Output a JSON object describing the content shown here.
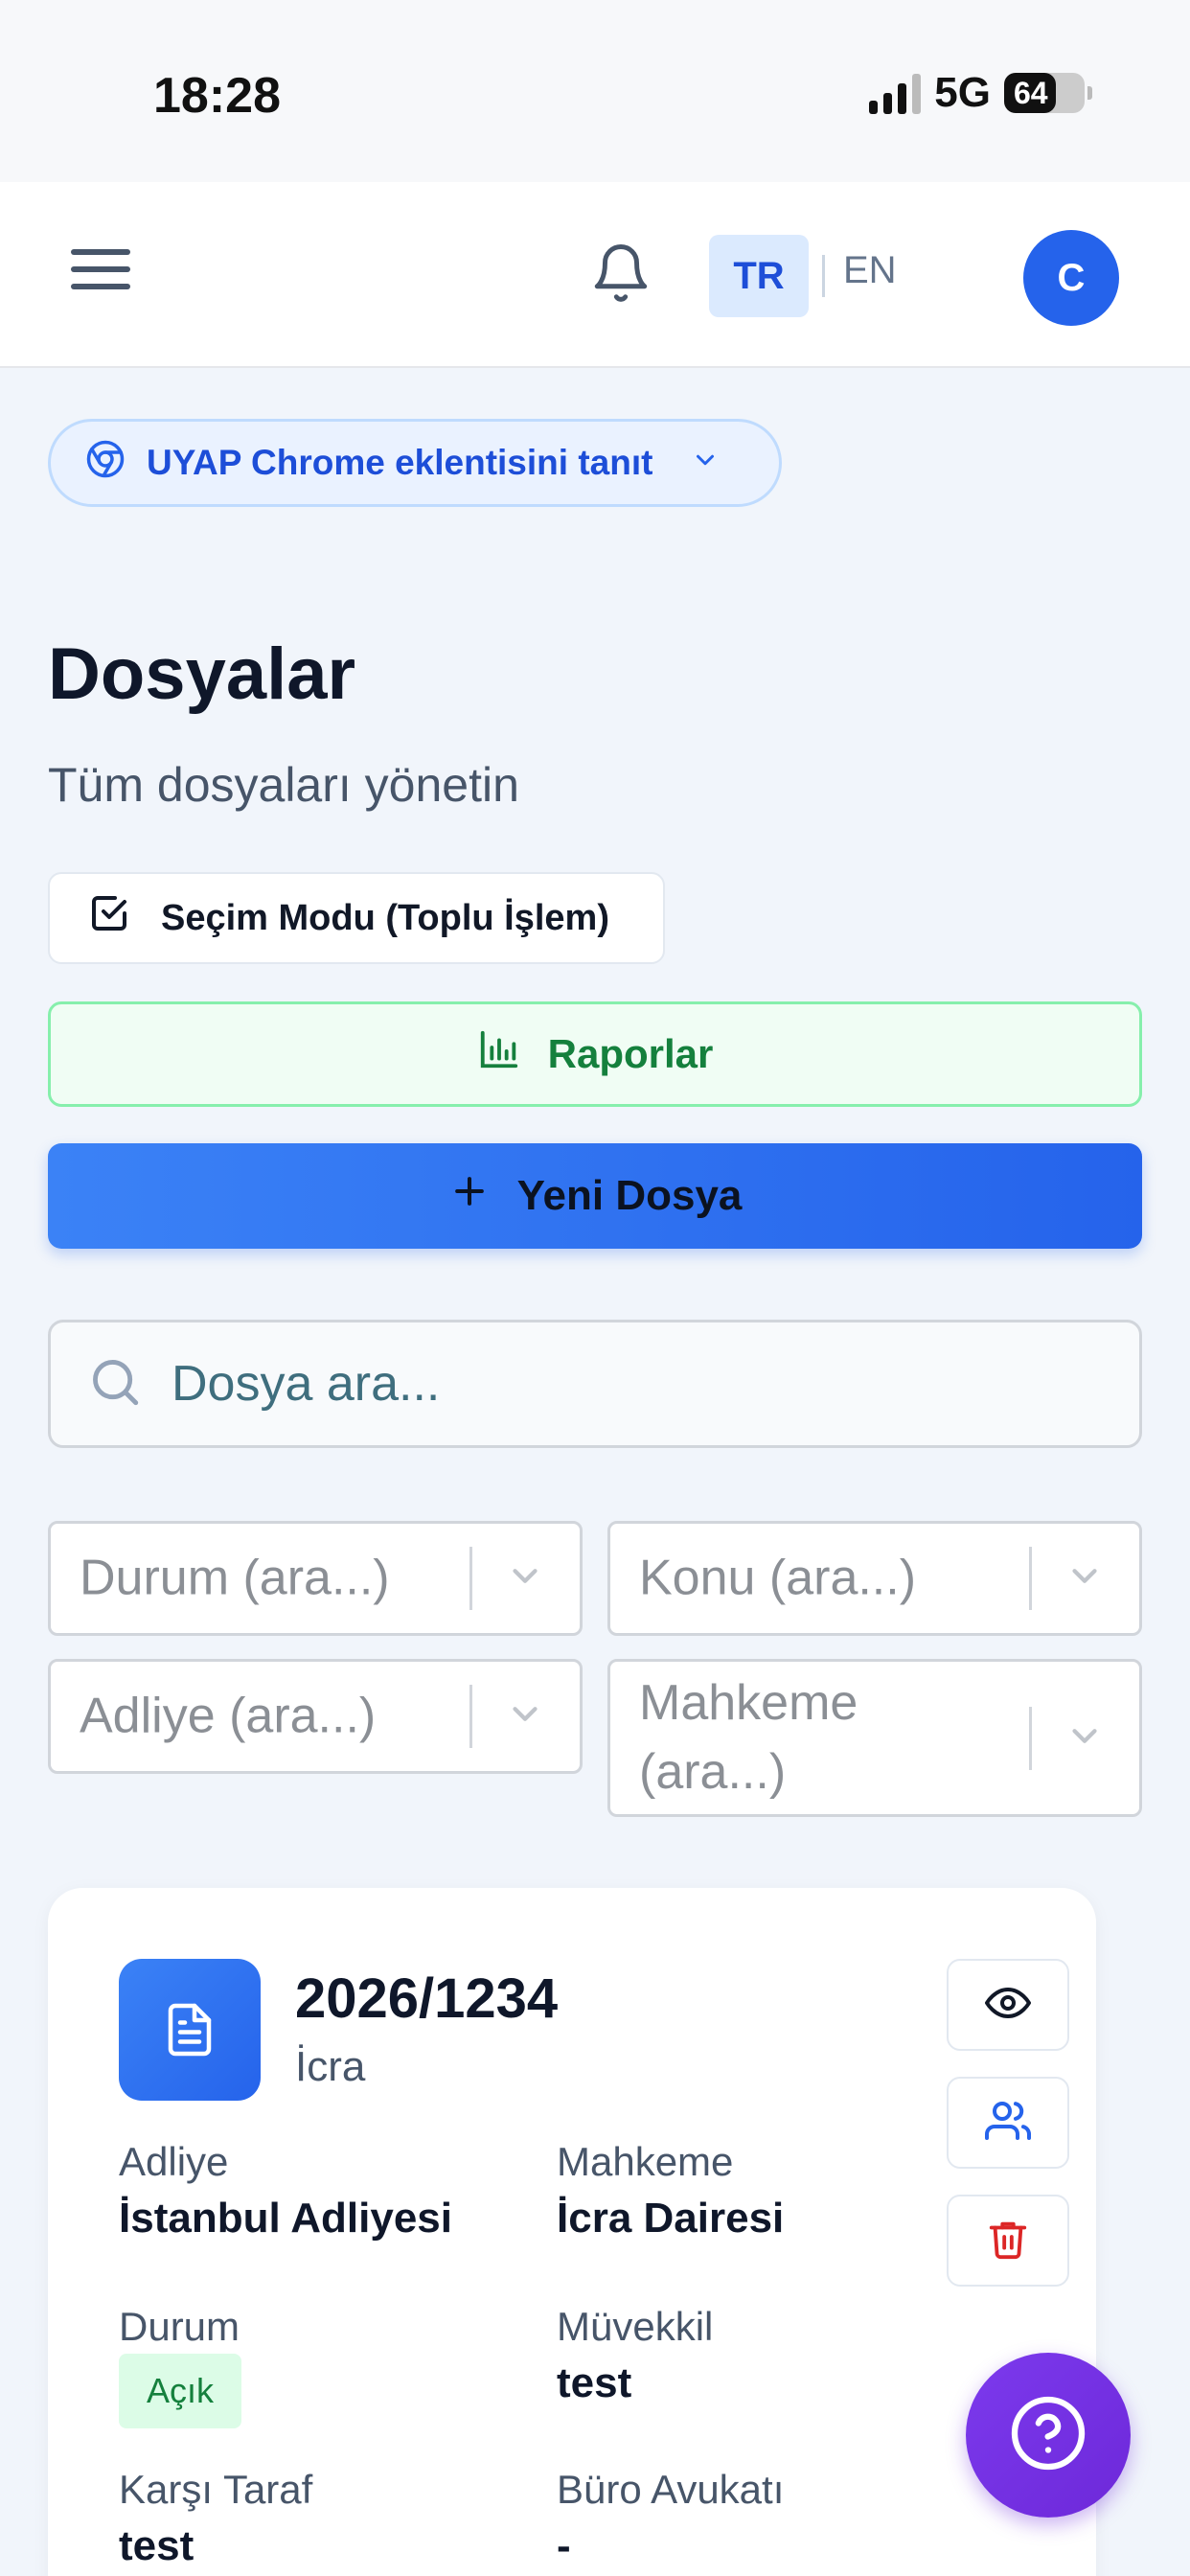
{
  "status_bar": {
    "time": "18:28",
    "network": "5G",
    "battery": "64",
    "battery_level": 0.64
  },
  "header": {
    "lang_active": "TR",
    "lang_other": "EN",
    "avatar_initial": "C"
  },
  "promo": {
    "label": "UYAP Chrome eklentisini tanıt"
  },
  "page": {
    "title": "Dosyalar",
    "subtitle": "Tüm dosyaları yönetin"
  },
  "actions": {
    "selection_mode": "Seçim Modu (Toplu İşlem)",
    "reports": "Raporlar",
    "new_file": "Yeni Dosya"
  },
  "search": {
    "placeholder": "Dosya ara..."
  },
  "filters": {
    "status": "Durum (ara...)",
    "subject": "Konu (ara...)",
    "courthouse": "Adliye (ara...)",
    "court_line1": "Mahkeme",
    "court_line2": "(ara...)"
  },
  "card": {
    "file_number": "2026/1234",
    "file_type": "İcra",
    "courthouse_label": "Adliye",
    "courthouse_value": "İstanbul Adliyesi",
    "court_label": "Mahkeme",
    "court_value": "İcra Dairesi",
    "status_label": "Durum",
    "status_value": "Açık",
    "client_label": "Müvekkil",
    "client_value": "test",
    "opponent_label": "Karşı Taraf",
    "opponent_value": "test",
    "lawyer_label": "Büro Avukatı",
    "lawyer_value": "-"
  },
  "colors": {
    "primary": "#2563eb",
    "success": "#15803d",
    "danger": "#dc2626",
    "help": "#7c3aed"
  }
}
